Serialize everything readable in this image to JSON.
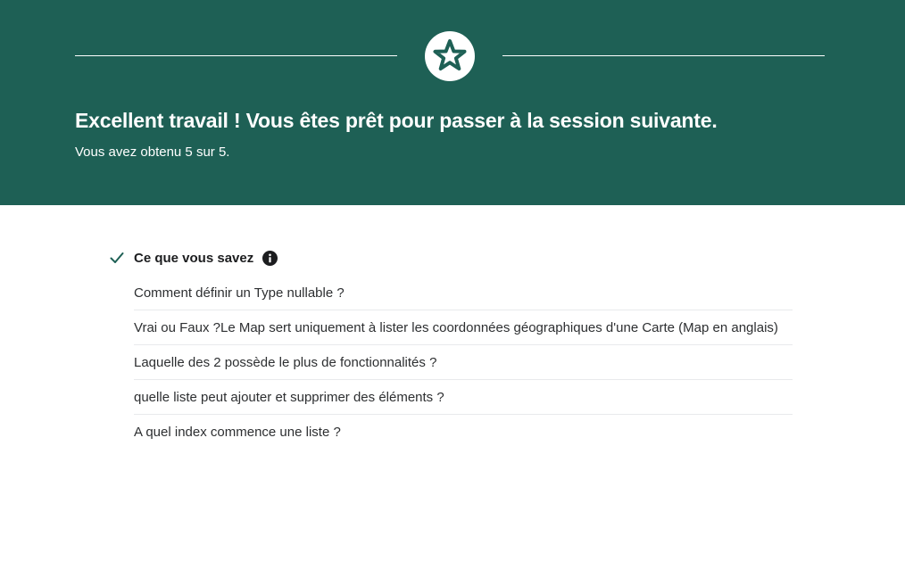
{
  "colors": {
    "banner_bg": "#1e6055",
    "check": "#1e6055",
    "text": "#1c1d1f"
  },
  "header": {
    "icon": "star-icon",
    "title": "Excellent travail ! Vous êtes prêt pour passer à la session suivante.",
    "score_text": "Vous avez obtenu 5 sur 5."
  },
  "results": {
    "section_title": "Ce que vous savez",
    "section_icon": "check-icon",
    "info_icon": "info-icon",
    "items": [
      "Comment définir un Type nullable ?",
      "Vrai ou Faux ?Le Map sert uniquement à lister les coordonnées géographiques d'une Carte (Map en anglais)",
      "Laquelle des 2 possède le plus de fonctionnalités ?",
      "quelle liste peut ajouter et supprimer des éléments ?",
      "A quel index commence une liste ?"
    ]
  }
}
